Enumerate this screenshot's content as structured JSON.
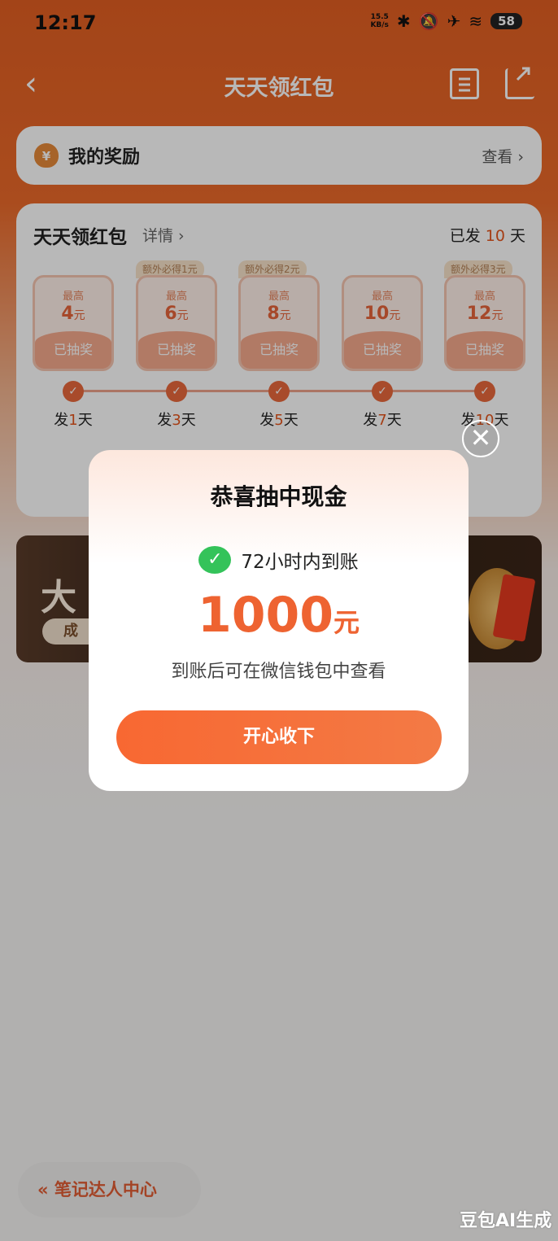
{
  "status_bar": {
    "time": "12:17",
    "net_speed_top": "15.5",
    "net_speed_bottom": "KB/s",
    "battery": "58"
  },
  "nav": {
    "title": "天天领红包"
  },
  "reward": {
    "title": "我的奖励",
    "link": "查看 ›"
  },
  "main": {
    "title": "天天领红包",
    "detail": "详情 ›",
    "sent_prefix": "已发",
    "sent_days": "10",
    "sent_suffix": "天",
    "boxes": [
      {
        "label": "最高",
        "amount": "4",
        "unit": "元",
        "status": "已抽奖",
        "bonus": "",
        "day_prefix": "发",
        "day": "1",
        "day_suffix": "天"
      },
      {
        "label": "最高",
        "amount": "6",
        "unit": "元",
        "status": "已抽奖",
        "bonus": "额外必得1元",
        "day_prefix": "发",
        "day": "3",
        "day_suffix": "天"
      },
      {
        "label": "最高",
        "amount": "8",
        "unit": "元",
        "status": "已抽奖",
        "bonus": "额外必得2元",
        "day_prefix": "发",
        "day": "5",
        "day_suffix": "天"
      },
      {
        "label": "最高",
        "amount": "10",
        "unit": "元",
        "status": "已抽奖",
        "bonus": "",
        "day_prefix": "发",
        "day": "7",
        "day_suffix": "天"
      },
      {
        "label": "最高",
        "amount": "12",
        "unit": "元",
        "status": "已抽奖",
        "bonus": "额外必得3元",
        "day_prefix": "发",
        "day": "10",
        "day_suffix": "天"
      }
    ]
  },
  "banner": {
    "big_text": "大",
    "pill_text": "成"
  },
  "dialog": {
    "title": "恭喜抽中现金",
    "pay_text": "72小时内到账",
    "amount": "1000",
    "unit": "元",
    "note": "到账后可在微信钱包中查看",
    "button": "开心收下"
  },
  "bottom": {
    "center_button": "« 笔记达人中心",
    "watermark": "豆包AI生成"
  }
}
